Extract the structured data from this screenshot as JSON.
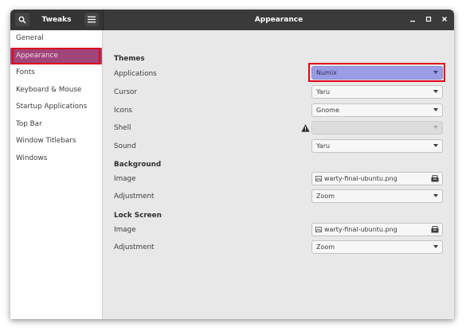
{
  "titlebar": {
    "app_title": "Tweaks",
    "page_title": "Appearance",
    "icons": [
      "search-icon",
      "hamburger-menu-icon",
      "minimize-icon",
      "maximize-icon",
      "close-icon"
    ]
  },
  "sidebar": {
    "items": [
      {
        "label": "General"
      },
      {
        "label": "Appearance",
        "active": true
      },
      {
        "label": "Fonts"
      },
      {
        "label": "Keyboard & Mouse"
      },
      {
        "label": "Startup Applications"
      },
      {
        "label": "Top Bar"
      },
      {
        "label": "Window Titlebars"
      },
      {
        "label": "Windows"
      }
    ]
  },
  "themes": {
    "heading": "Themes",
    "applications": {
      "label": "Applications",
      "value": "Numix"
    },
    "cursor": {
      "label": "Cursor",
      "value": "Yaru"
    },
    "icons": {
      "label": "Icons",
      "value": "Gnome"
    },
    "shell": {
      "label": "Shell",
      "value": "",
      "warning_icon": "warning-icon"
    },
    "sound": {
      "label": "Sound",
      "value": "Yaru"
    }
  },
  "background": {
    "heading": "Background",
    "image": {
      "label": "Image",
      "value": "warty-final-ubuntu.png"
    },
    "adjustment": {
      "label": "Adjustment",
      "value": "Zoom"
    }
  },
  "lock_screen": {
    "heading": "Lock Screen",
    "image": {
      "label": "Image",
      "value": "warty-final-ubuntu.png"
    },
    "adjustment": {
      "label": "Adjustment",
      "value": "Zoom"
    }
  },
  "colors": {
    "titlebar": "#3a3a3a",
    "sidebar_active": "#a0457a",
    "highlight_combo": "#9b9ce6",
    "annotation_red": "#e0001a"
  }
}
